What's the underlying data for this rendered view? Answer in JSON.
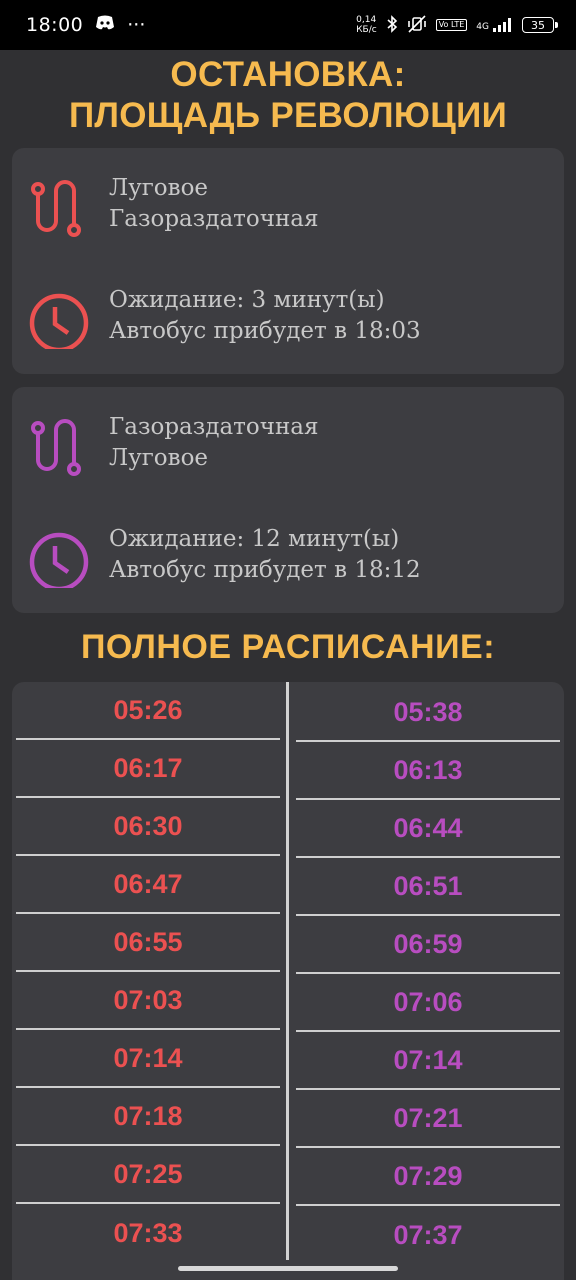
{
  "status_bar": {
    "time": "18:00",
    "dots": "···",
    "net_speed_value": "0,14",
    "net_speed_unit": "КБ/с",
    "volte": "Vo LTE",
    "network": "4G",
    "battery": "35"
  },
  "stop": {
    "title_line1": "ОСТАНОВКА:",
    "title_line2": "ПЛОЩАДЬ РЕВОЛЮЦИИ"
  },
  "routes": [
    {
      "color": "#eb5151",
      "from": "Луговое",
      "to": "Газораздаточная",
      "wait_text": "Ожидание: 3 минут(ы)",
      "arrival_text": "Автобус прибудет в 18:03",
      "route_icon": "route-icon",
      "clock_icon": "clock-icon"
    },
    {
      "color": "#b84dc0",
      "from": "Газораздаточная",
      "to": "Луговое",
      "wait_text": "Ожидание: 12 минут(ы)",
      "arrival_text": "Автобус прибудет в 18:12",
      "route_icon": "route-icon",
      "clock_icon": "clock-icon"
    }
  ],
  "schedule": {
    "title": "ПОЛНОЕ РАСПИСАНИЕ:",
    "left_times": [
      "05:26",
      "06:17",
      "06:30",
      "06:47",
      "06:55",
      "07:03",
      "07:14",
      "07:18",
      "07:25",
      "07:33"
    ],
    "right_times": [
      "05:38",
      "06:13",
      "06:44",
      "06:51",
      "06:59",
      "07:06",
      "07:14",
      "07:21",
      "07:29",
      "07:37"
    ]
  }
}
